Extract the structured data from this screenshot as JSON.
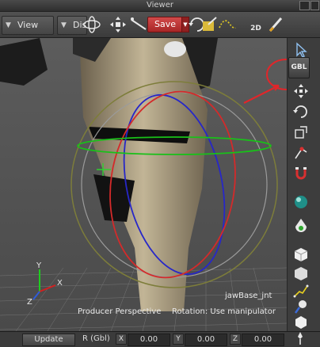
{
  "window": {
    "title": "Viewer"
  },
  "toolbar": {
    "view_menu_label": "View",
    "display_menu_label": "Disp",
    "save_label": "Save",
    "view_2d_label": "2D"
  },
  "viewport": {
    "camera_label": "Producer Perspective",
    "rotation_label": "Rotation: Use manipulator",
    "selected_object_label": "jawBase_jnt",
    "axis_x_label": "X",
    "axis_y_label": "Y",
    "axis_z_label": "Z"
  },
  "sidebar": {
    "global_mode_label": "GBL",
    "buttons": [
      "select-arrow",
      "global-mode",
      "translate",
      "rotate",
      "scale",
      "transform-constraint",
      "magnet",
      "globe-render",
      "visibility-paint",
      "cube-solid",
      "cube-wire",
      "path",
      "light-bulb",
      "hexagon",
      "pin"
    ]
  },
  "statusbar": {
    "update_label": "Update",
    "rotation_mode_label": "R (Gbl)",
    "x_label": "X",
    "x_value": "0.00",
    "y_label": "Y",
    "y_value": "0.00",
    "z_label": "Z",
    "z_value": "0.00"
  },
  "colors": {
    "manipulator_x": "#d42a2a",
    "manipulator_y": "#19c019",
    "manipulator_z": "#2727c8",
    "manipulator_outer": "#7d7d3a",
    "annotation": "#e0262a"
  }
}
